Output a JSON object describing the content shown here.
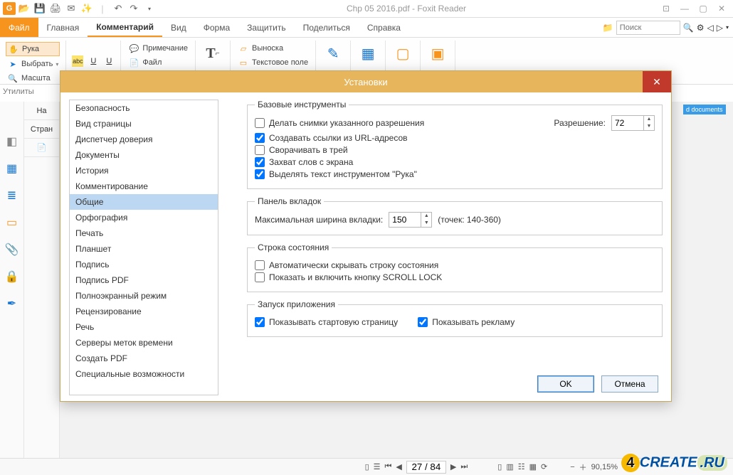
{
  "title": "Chp 05 2016.pdf - Foxit Reader",
  "menu": {
    "file": "Файл",
    "home": "Главная",
    "comment": "Комментарий",
    "view": "Вид",
    "form": "Форма",
    "protect": "Защитить",
    "share": "Поделиться",
    "help": "Справка"
  },
  "search_placeholder": "Поиск",
  "ribbon": {
    "hand": "Рука",
    "select": "Выбрать",
    "scale": "Масшта",
    "util": "Утилиты",
    "note": "Примечание",
    "filebtn": "Файл",
    "callout": "Выноска",
    "textbox": "Текстовое поле"
  },
  "panel": {
    "start_tab": "На",
    "pages_tab": "Стран"
  },
  "bg_badge": "d documents",
  "dialog": {
    "title": "Установки",
    "list": [
      "Безопасность",
      "Вид страницы",
      "Диспетчер доверия",
      "Документы",
      "История",
      "Комментирование",
      "Общие",
      "Орфография",
      "Печать",
      "Планшет",
      "Подпись",
      "Подпись PDF",
      "Полноэкранный режим",
      "Рецензирование",
      "Речь",
      "Серверы меток времени",
      "Создать PDF",
      "Специальные возможности"
    ],
    "selected_index": 6,
    "group1": {
      "legend": "Базовые инструменты",
      "c1": "Делать снимки указанного разрешения",
      "res_label": "Разрешение:",
      "res_value": "72",
      "c2": "Создавать ссылки из URL-адресов",
      "c3": "Сворачивать в трей",
      "c4": "Захват слов с экрана",
      "c5": "Выделять текст инструментом \"Рука\""
    },
    "group2": {
      "legend": "Панель вкладок",
      "label": "Максимальная ширина вкладки:",
      "value": "150",
      "hint": "(точек: 140-360)"
    },
    "group3": {
      "legend": "Строка состояния",
      "c1": "Автоматически скрывать строку состояния",
      "c2": "Показать и включить кнопку SCROLL LOCK"
    },
    "group4": {
      "legend": "Запуск приложения",
      "c1": "Показывать стартовую страницу",
      "c2": "Показывать рекламу"
    },
    "ok": "OK",
    "cancel": "Отмена"
  },
  "status": {
    "page": "27 / 84",
    "zoom": "90,15%"
  },
  "watermark": {
    "brand": "CREATE",
    "tld": ".RU",
    "four": "4"
  }
}
